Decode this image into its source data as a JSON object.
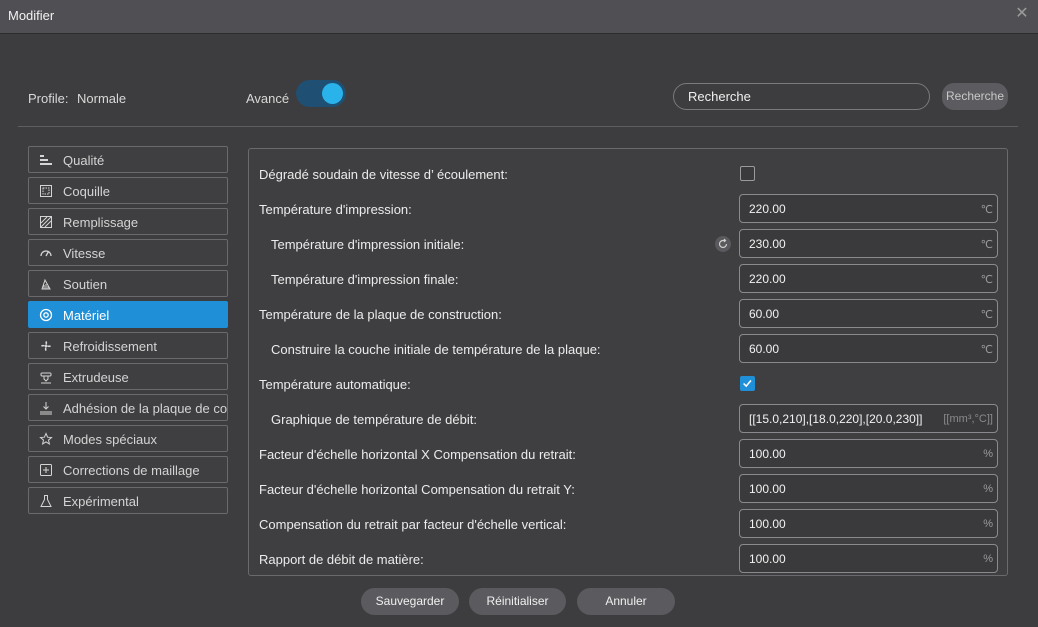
{
  "window": {
    "title": "Modifier"
  },
  "top": {
    "profile_label": "Profile:",
    "profile_value": "Normale",
    "advanced_label": "Avancé",
    "advanced_on": true,
    "search_value": "Recherche",
    "search_button": "Recherche"
  },
  "sidebar": {
    "items": [
      {
        "label": "Qualité",
        "icon": "quality-icon"
      },
      {
        "label": "Coquille",
        "icon": "shell-icon"
      },
      {
        "label": "Remplissage",
        "icon": "infill-icon"
      },
      {
        "label": "Vitesse",
        "icon": "speed-icon"
      },
      {
        "label": "Soutien",
        "icon": "support-icon"
      },
      {
        "label": "Matériel",
        "icon": "material-icon",
        "active": true
      },
      {
        "label": "Refroidissement",
        "icon": "fan-icon"
      },
      {
        "label": "Extrudeuse",
        "icon": "extruder-icon"
      },
      {
        "label": "Adhésion de la plaque de co",
        "icon": "adhesion-icon"
      },
      {
        "label": "Modes spéciaux",
        "icon": "star-icon"
      },
      {
        "label": "Corrections de maillage",
        "icon": "mesh-fix-icon"
      },
      {
        "label": "Expérimental",
        "icon": "flask-icon"
      }
    ]
  },
  "settings": [
    {
      "label": "Dégradé soudain de vitesse d’ écoulement:",
      "type": "checkbox",
      "checked": false
    },
    {
      "label": "Température d'impression:",
      "type": "field",
      "value": "220.00",
      "unit": "℃"
    },
    {
      "label": "Température d'impression initiale:",
      "type": "field",
      "value": "230.00",
      "unit": "℃",
      "sub": true,
      "reset": true
    },
    {
      "label": "Température d'impression finale:",
      "type": "field",
      "value": "220.00",
      "unit": "℃",
      "sub": true
    },
    {
      "label": "Température de la plaque de construction:",
      "type": "field",
      "value": "60.00",
      "unit": "℃"
    },
    {
      "label": "Construire la couche initiale de température de la plaque:",
      "type": "field",
      "value": "60.00",
      "unit": "℃",
      "sub": true
    },
    {
      "label": "Température automatique:",
      "type": "checkbox",
      "checked": true
    },
    {
      "label": "Graphique de température de débit:",
      "type": "field",
      "value": "[[15.0,210],[18.0,220],[20.0,230]]",
      "unit": "[[mm³,°C]]",
      "sub": true
    },
    {
      "label": "Facteur d'échelle horizontal X Compensation du retrait:",
      "type": "field",
      "value": "100.00",
      "unit": "%"
    },
    {
      "label": "Facteur d'échelle horizontal Compensation du retrait Y:",
      "type": "field",
      "value": "100.00",
      "unit": "%"
    },
    {
      "label": "Compensation du retrait par facteur d'échelle vertical:",
      "type": "field",
      "value": "100.00",
      "unit": "%"
    },
    {
      "label": "Rapport de débit de matière:",
      "type": "field",
      "value": "100.00",
      "unit": "%"
    }
  ],
  "footer": {
    "save": "Sauvegarder",
    "reset": "Réinitialiser",
    "cancel": "Annuler"
  },
  "colors": {
    "accent": "#1f8fd8",
    "toggle_knob": "#2ab3ea",
    "background": "#3d3d3f"
  }
}
